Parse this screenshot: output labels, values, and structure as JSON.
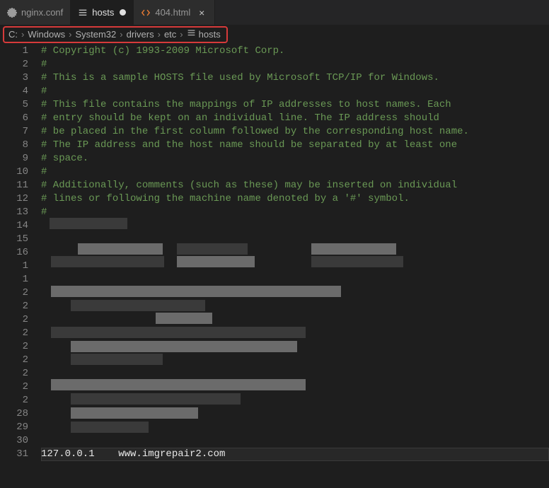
{
  "tabs": [
    {
      "label": "nginx.conf",
      "icon": "gear",
      "active": false,
      "dirty": false
    },
    {
      "label": "hosts",
      "icon": "lines",
      "active": true,
      "dirty": true
    },
    {
      "label": "404.html",
      "icon": "code",
      "active": false,
      "dirty": false
    }
  ],
  "breadcrumb": {
    "segments": [
      {
        "label": "C:"
      },
      {
        "label": "Windows"
      },
      {
        "label": "System32"
      },
      {
        "label": "drivers"
      },
      {
        "label": "etc"
      },
      {
        "label": "hosts",
        "icon": "lines"
      }
    ]
  },
  "editor": {
    "lines": [
      {
        "n": 1,
        "text": "# Copyright (c) 1993-2009 Microsoft Corp.",
        "cls": "comment"
      },
      {
        "n": 2,
        "text": "#",
        "cls": "comment"
      },
      {
        "n": 3,
        "text": "# This is a sample HOSTS file used by Microsoft TCP/IP for Windows.",
        "cls": "comment"
      },
      {
        "n": 4,
        "text": "#",
        "cls": "comment"
      },
      {
        "n": 5,
        "text": "# This file contains the mappings of IP addresses to host names. Each",
        "cls": "comment"
      },
      {
        "n": 6,
        "text": "# entry should be kept on an individual line. The IP address should",
        "cls": "comment"
      },
      {
        "n": 7,
        "text": "# be placed in the first column followed by the corresponding host name.",
        "cls": "comment"
      },
      {
        "n": 8,
        "text": "# The IP address and the host name should be separated by at least one",
        "cls": "comment"
      },
      {
        "n": 9,
        "text": "# space.",
        "cls": "comment"
      },
      {
        "n": 10,
        "text": "#",
        "cls": "comment"
      },
      {
        "n": 11,
        "text": "# Additionally, comments (such as these) may be inserted on individual",
        "cls": "comment"
      },
      {
        "n": 12,
        "text": "# lines or following the machine name denoted by a '#' symbol.",
        "cls": "comment"
      },
      {
        "n": 13,
        "text": "#",
        "cls": "comment"
      },
      {
        "n": 14,
        "text": "",
        "cls": ""
      },
      {
        "n": 15,
        "text": "",
        "cls": ""
      },
      {
        "n": 16,
        "text": "",
        "cls": ""
      },
      {
        "n": 1,
        "text": "",
        "cls": ""
      },
      {
        "n": 1,
        "text": "",
        "cls": ""
      },
      {
        "n": 2,
        "text": "",
        "cls": ""
      },
      {
        "n": 2,
        "text": "",
        "cls": ""
      },
      {
        "n": 2,
        "text": "",
        "cls": ""
      },
      {
        "n": 2,
        "text": "",
        "cls": ""
      },
      {
        "n": 2,
        "text": "",
        "cls": ""
      },
      {
        "n": 2,
        "text": "",
        "cls": ""
      },
      {
        "n": 2,
        "text": "",
        "cls": ""
      },
      {
        "n": 2,
        "text": "",
        "cls": ""
      },
      {
        "n": 2,
        "text": "",
        "cls": ""
      },
      {
        "n": 28,
        "text": "",
        "cls": ""
      },
      {
        "n": 29,
        "text": "",
        "cls": ""
      },
      {
        "n": 30,
        "text": "",
        "cls": ""
      },
      {
        "n": 31,
        "text": "127.0.0.1    www.imgrepair2.com",
        "cls": "txt",
        "current": true
      }
    ]
  }
}
